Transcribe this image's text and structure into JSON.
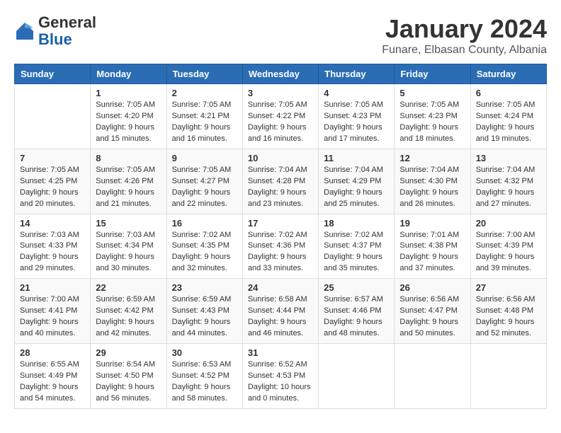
{
  "logo": {
    "general": "General",
    "blue": "Blue"
  },
  "title": "January 2024",
  "location": "Funare, Elbasan County, Albania",
  "days_of_week": [
    "Sunday",
    "Monday",
    "Tuesday",
    "Wednesday",
    "Thursday",
    "Friday",
    "Saturday"
  ],
  "weeks": [
    [
      {
        "day": "",
        "info": ""
      },
      {
        "day": "1",
        "info": "Sunrise: 7:05 AM\nSunset: 4:20 PM\nDaylight: 9 hours\nand 15 minutes."
      },
      {
        "day": "2",
        "info": "Sunrise: 7:05 AM\nSunset: 4:21 PM\nDaylight: 9 hours\nand 16 minutes."
      },
      {
        "day": "3",
        "info": "Sunrise: 7:05 AM\nSunset: 4:22 PM\nDaylight: 9 hours\nand 16 minutes."
      },
      {
        "day": "4",
        "info": "Sunrise: 7:05 AM\nSunset: 4:23 PM\nDaylight: 9 hours\nand 17 minutes."
      },
      {
        "day": "5",
        "info": "Sunrise: 7:05 AM\nSunset: 4:23 PM\nDaylight: 9 hours\nand 18 minutes."
      },
      {
        "day": "6",
        "info": "Sunrise: 7:05 AM\nSunset: 4:24 PM\nDaylight: 9 hours\nand 19 minutes."
      }
    ],
    [
      {
        "day": "7",
        "info": "Sunrise: 7:05 AM\nSunset: 4:25 PM\nDaylight: 9 hours\nand 20 minutes."
      },
      {
        "day": "8",
        "info": "Sunrise: 7:05 AM\nSunset: 4:26 PM\nDaylight: 9 hours\nand 21 minutes."
      },
      {
        "day": "9",
        "info": "Sunrise: 7:05 AM\nSunset: 4:27 PM\nDaylight: 9 hours\nand 22 minutes."
      },
      {
        "day": "10",
        "info": "Sunrise: 7:04 AM\nSunset: 4:28 PM\nDaylight: 9 hours\nand 23 minutes."
      },
      {
        "day": "11",
        "info": "Sunrise: 7:04 AM\nSunset: 4:29 PM\nDaylight: 9 hours\nand 25 minutes."
      },
      {
        "day": "12",
        "info": "Sunrise: 7:04 AM\nSunset: 4:30 PM\nDaylight: 9 hours\nand 26 minutes."
      },
      {
        "day": "13",
        "info": "Sunrise: 7:04 AM\nSunset: 4:32 PM\nDaylight: 9 hours\nand 27 minutes."
      }
    ],
    [
      {
        "day": "14",
        "info": "Sunrise: 7:03 AM\nSunset: 4:33 PM\nDaylight: 9 hours\nand 29 minutes."
      },
      {
        "day": "15",
        "info": "Sunrise: 7:03 AM\nSunset: 4:34 PM\nDaylight: 9 hours\nand 30 minutes."
      },
      {
        "day": "16",
        "info": "Sunrise: 7:02 AM\nSunset: 4:35 PM\nDaylight: 9 hours\nand 32 minutes."
      },
      {
        "day": "17",
        "info": "Sunrise: 7:02 AM\nSunset: 4:36 PM\nDaylight: 9 hours\nand 33 minutes."
      },
      {
        "day": "18",
        "info": "Sunrise: 7:02 AM\nSunset: 4:37 PM\nDaylight: 9 hours\nand 35 minutes."
      },
      {
        "day": "19",
        "info": "Sunrise: 7:01 AM\nSunset: 4:38 PM\nDaylight: 9 hours\nand 37 minutes."
      },
      {
        "day": "20",
        "info": "Sunrise: 7:00 AM\nSunset: 4:39 PM\nDaylight: 9 hours\nand 39 minutes."
      }
    ],
    [
      {
        "day": "21",
        "info": "Sunrise: 7:00 AM\nSunset: 4:41 PM\nDaylight: 9 hours\nand 40 minutes."
      },
      {
        "day": "22",
        "info": "Sunrise: 6:59 AM\nSunset: 4:42 PM\nDaylight: 9 hours\nand 42 minutes."
      },
      {
        "day": "23",
        "info": "Sunrise: 6:59 AM\nSunset: 4:43 PM\nDaylight: 9 hours\nand 44 minutes."
      },
      {
        "day": "24",
        "info": "Sunrise: 6:58 AM\nSunset: 4:44 PM\nDaylight: 9 hours\nand 46 minutes."
      },
      {
        "day": "25",
        "info": "Sunrise: 6:57 AM\nSunset: 4:46 PM\nDaylight: 9 hours\nand 48 minutes."
      },
      {
        "day": "26",
        "info": "Sunrise: 6:56 AM\nSunset: 4:47 PM\nDaylight: 9 hours\nand 50 minutes."
      },
      {
        "day": "27",
        "info": "Sunrise: 6:56 AM\nSunset: 4:48 PM\nDaylight: 9 hours\nand 52 minutes."
      }
    ],
    [
      {
        "day": "28",
        "info": "Sunrise: 6:55 AM\nSunset: 4:49 PM\nDaylight: 9 hours\nand 54 minutes."
      },
      {
        "day": "29",
        "info": "Sunrise: 6:54 AM\nSunset: 4:50 PM\nDaylight: 9 hours\nand 56 minutes."
      },
      {
        "day": "30",
        "info": "Sunrise: 6:53 AM\nSunset: 4:52 PM\nDaylight: 9 hours\nand 58 minutes."
      },
      {
        "day": "31",
        "info": "Sunrise: 6:52 AM\nSunset: 4:53 PM\nDaylight: 10 hours\nand 0 minutes."
      },
      {
        "day": "",
        "info": ""
      },
      {
        "day": "",
        "info": ""
      },
      {
        "day": "",
        "info": ""
      }
    ]
  ]
}
